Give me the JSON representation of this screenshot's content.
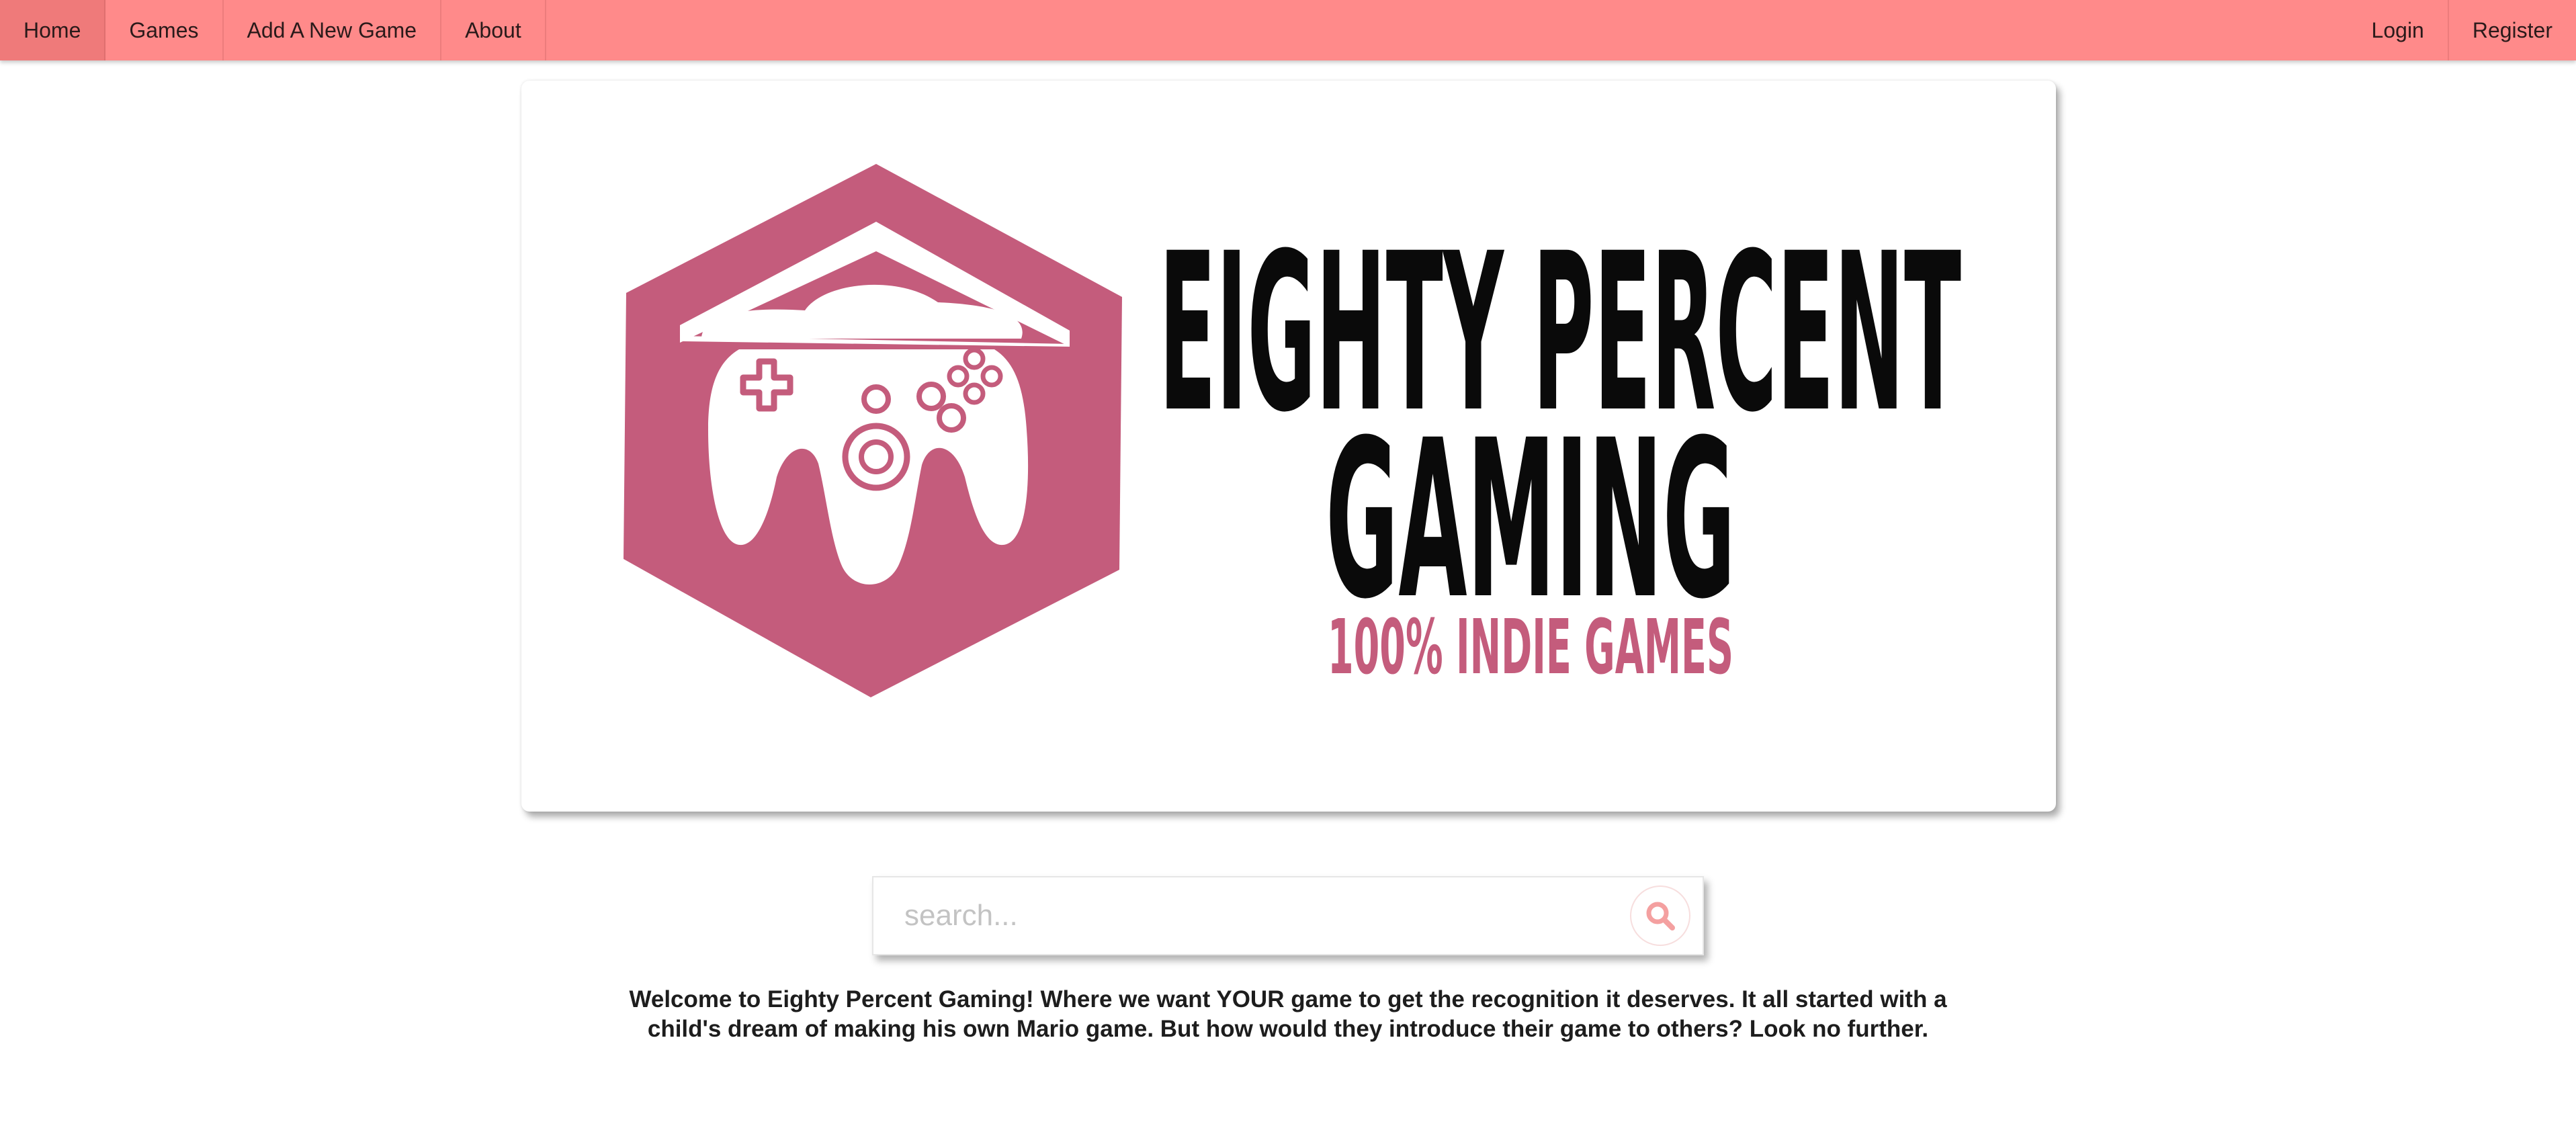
{
  "nav": {
    "left_items": [
      {
        "label": "Home",
        "active": true
      },
      {
        "label": "Games",
        "active": false
      },
      {
        "label": "Add A New Game",
        "active": false
      },
      {
        "label": "About",
        "active": false
      }
    ],
    "right_items": [
      {
        "label": "Login"
      },
      {
        "label": "Register"
      }
    ]
  },
  "hero": {
    "logo": {
      "line1": "EIGHTY PERCENT",
      "line2": "GAMING",
      "tagline": "100% INDIE GAMES",
      "icon": "game-controller-hexagon-icon",
      "brand_color": "#c45c7c",
      "text_color": "#0a0a0a"
    }
  },
  "search": {
    "placeholder": "search...",
    "value": "",
    "icon": "search-icon"
  },
  "welcome_text": "Welcome to Eighty Percent Gaming! Where we want YOUR game to get the recognition it deserves. It all started with a child's dream of making his own Mario game. But how would they introduce their game to others? Look no further.",
  "colors": {
    "navbar": "#ff8a8a",
    "navbar_active": "#ef7a7a",
    "accent": "#c45c7c",
    "search_icon": "#f4a0a0"
  }
}
